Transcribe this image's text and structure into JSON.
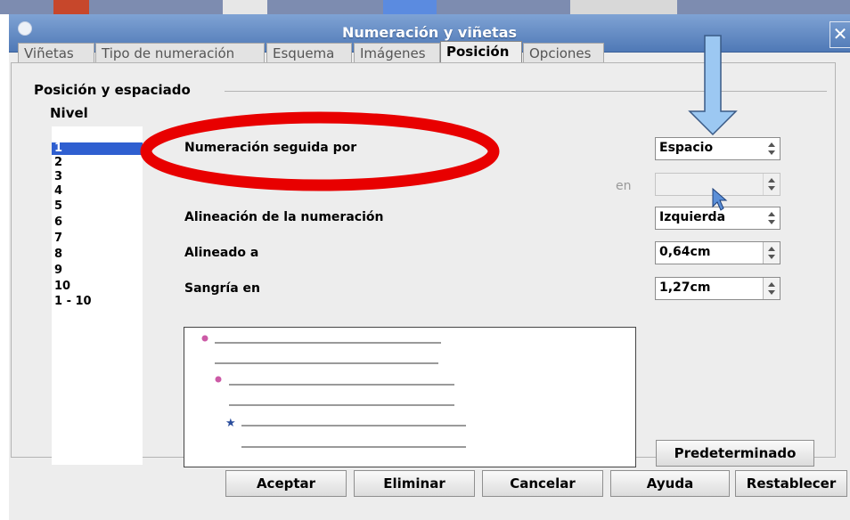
{
  "dialog": {
    "title": "Numeración y viñetas",
    "close_glyph": "✕"
  },
  "tabs": [
    {
      "label": "Viñetas",
      "active": false
    },
    {
      "label": "Tipo de numeración",
      "active": false
    },
    {
      "label": "Esquema",
      "active": false
    },
    {
      "label": "Imágenes",
      "active": false
    },
    {
      "label": "Posición",
      "active": true
    },
    {
      "label": "Opciones",
      "active": false
    }
  ],
  "section": {
    "title": "Posición y espaciado",
    "level_label": "Nivel"
  },
  "levels": [
    "1",
    "2",
    "3",
    "4",
    "5",
    "6",
    "7",
    "8",
    "9",
    "10",
    "1 - 10"
  ],
  "selected_level": "1",
  "form": {
    "numbering_followed_by": {
      "label": "Numeración seguida por",
      "value": "Espacio"
    },
    "at": {
      "label": "en",
      "value": ""
    },
    "numbering_alignment": {
      "label": "Alineación de la numeración",
      "value": "Izquierda"
    },
    "aligned_at": {
      "label": "Alineado a",
      "value": "0,64cm"
    },
    "indent_at": {
      "label": "Sangría en",
      "value": "1,27cm"
    }
  },
  "preview": {
    "bullets": [
      "dot",
      "dot",
      "star"
    ],
    "bullet_colors": [
      "#cc5aa6",
      "#cc5aa6",
      "#2a4d9c"
    ]
  },
  "buttons": {
    "default": "Predeterminado",
    "ok": "Aceptar",
    "delete": "Eliminar",
    "cancel": "Cancelar",
    "help": "Ayuda",
    "reset": "Restablecer"
  },
  "annotations": {
    "ellipse_color": "#e80000",
    "arrow_color": "#9cc8f2"
  }
}
